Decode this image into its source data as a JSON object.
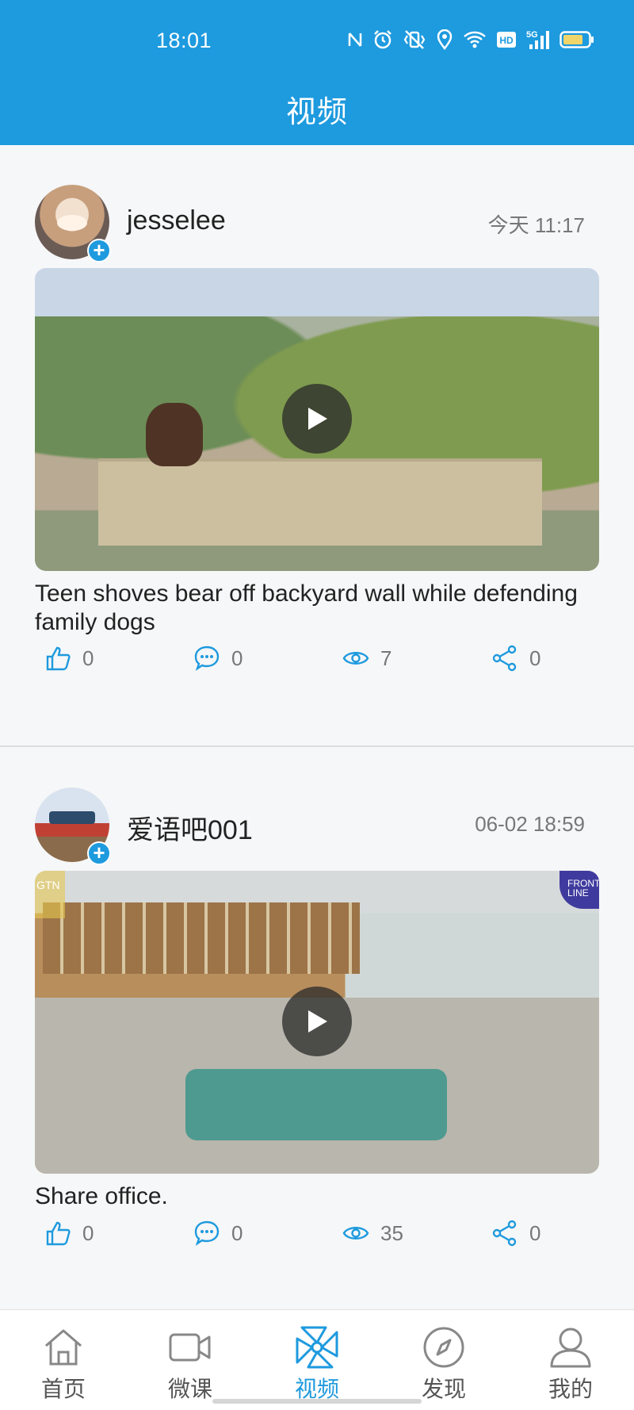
{
  "status_bar": {
    "time": "18:01",
    "icons": [
      "nfc-icon",
      "alarm-icon",
      "vibrate-icon",
      "location-icon",
      "wifi-icon",
      "hd-icon",
      "signal-5g-icon",
      "battery-icon"
    ],
    "hd_label": "HD",
    "network_label": "5G"
  },
  "header": {
    "title": "视频"
  },
  "posts": [
    {
      "username": "jesselee",
      "time": "今天 11:17",
      "caption": "Teen shoves bear off backyard wall while defending family dogs",
      "likes": "0",
      "comments": "0",
      "views": "7",
      "shares": "0"
    },
    {
      "username": "爱语吧001",
      "time": "06-02 18:59",
      "caption": "Share office.",
      "likes": "0",
      "comments": "0",
      "views": "35",
      "shares": "0",
      "video_badge": "FRONT LINE",
      "video_logo": "GTN"
    }
  ],
  "bottom_nav": {
    "items": [
      {
        "label": "首页",
        "icon": "home-icon"
      },
      {
        "label": "微课",
        "icon": "video-camera-icon"
      },
      {
        "label": "视频",
        "icon": "pinwheel-icon"
      },
      {
        "label": "发现",
        "icon": "compass-icon"
      },
      {
        "label": "我的",
        "icon": "user-icon"
      }
    ],
    "active_index": 2
  },
  "colors": {
    "primary": "#1e9ade",
    "text": "#222222",
    "muted": "#777777",
    "background": "#f6f7f8"
  }
}
